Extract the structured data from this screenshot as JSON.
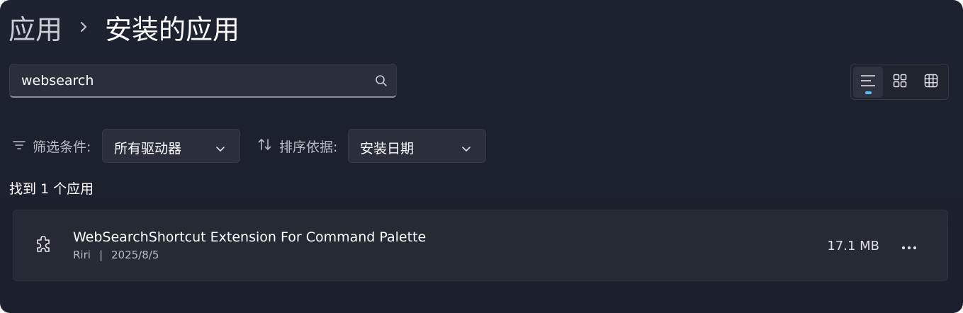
{
  "header": {
    "breadcrumb_parent": "应用",
    "breadcrumb_current": "安装的应用"
  },
  "search": {
    "value": "websearch",
    "icon": "search-icon"
  },
  "view_toggle": {
    "options": [
      "list-view-icon",
      "tile-view-icon",
      "grid-view-icon"
    ],
    "selected": "list-view-icon",
    "accent": "#4cc2ff"
  },
  "filter": {
    "label": "筛选条件:",
    "selected": "所有驱动器",
    "icon": "filter-icon"
  },
  "sort": {
    "label": "排序依据:",
    "selected": "安装日期",
    "icon": "sort-icon"
  },
  "results": {
    "count_text": "找到 1 个应用"
  },
  "apps": [
    {
      "name": "WebSearchShortcut Extension For Command Palette",
      "publisher": "Riri",
      "separator": "|",
      "date": "2025/8/5",
      "size": "17.1 MB",
      "icon": "puzzle-piece-icon"
    }
  ]
}
